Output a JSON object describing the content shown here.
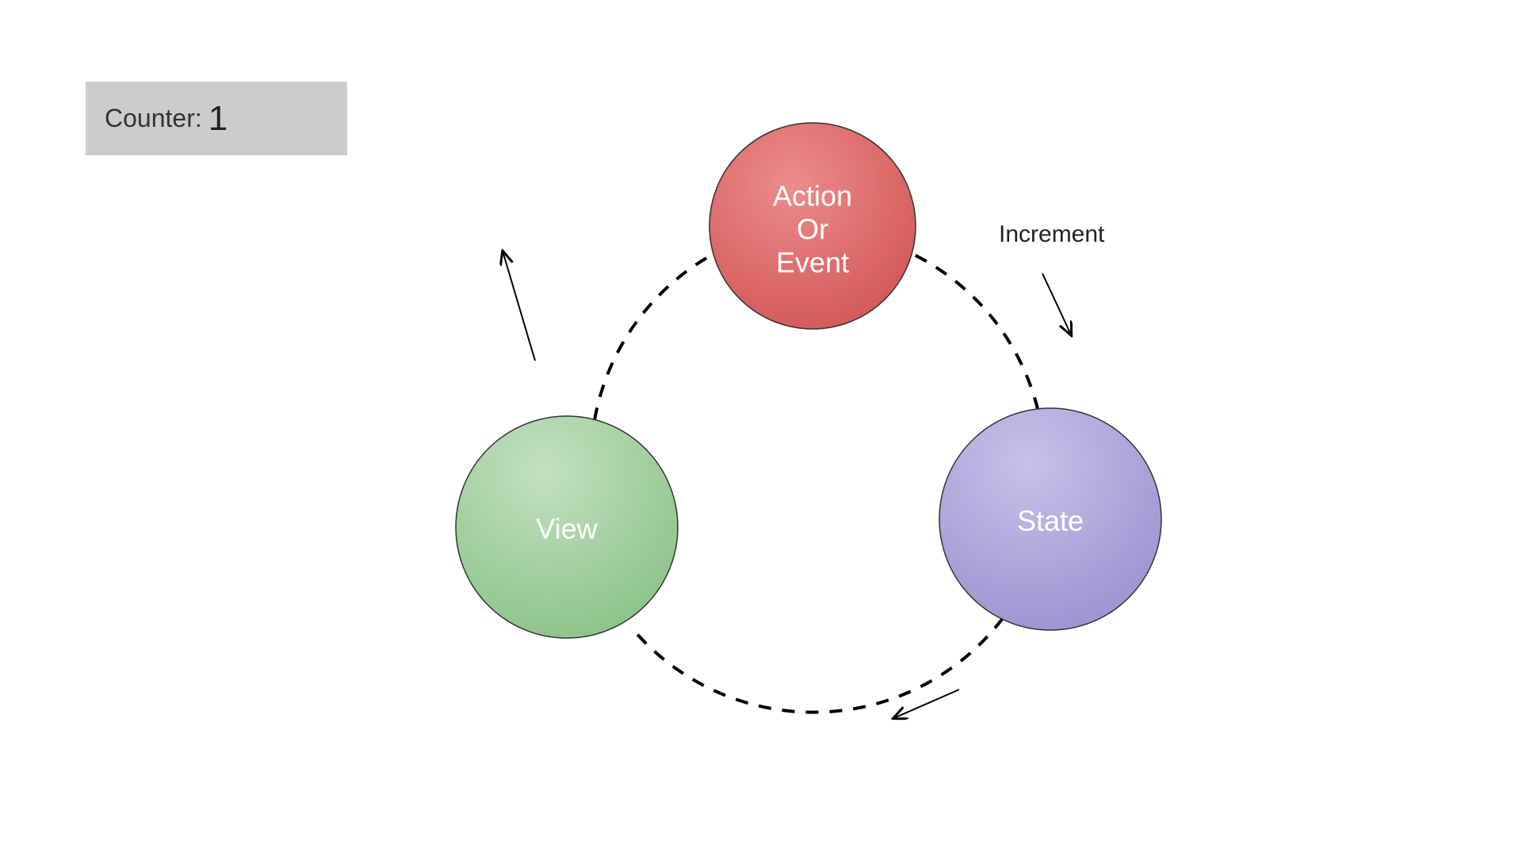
{
  "counter": {
    "label": "Counter:",
    "value": "1"
  },
  "diagram": {
    "nodes": {
      "action": {
        "line1": "Action",
        "line2": "Or",
        "line3": "Event",
        "color_top": "#ec8c8c",
        "color_bottom": "#d35858"
      },
      "state": {
        "label": "State",
        "color_top": "#c8c1e8",
        "color_bottom": "#9d92d1"
      },
      "view": {
        "label": "View",
        "color_top": "#c3e1c0",
        "color_bottom": "#8bc388"
      }
    },
    "edges": {
      "action_to_state": "Increment"
    }
  }
}
